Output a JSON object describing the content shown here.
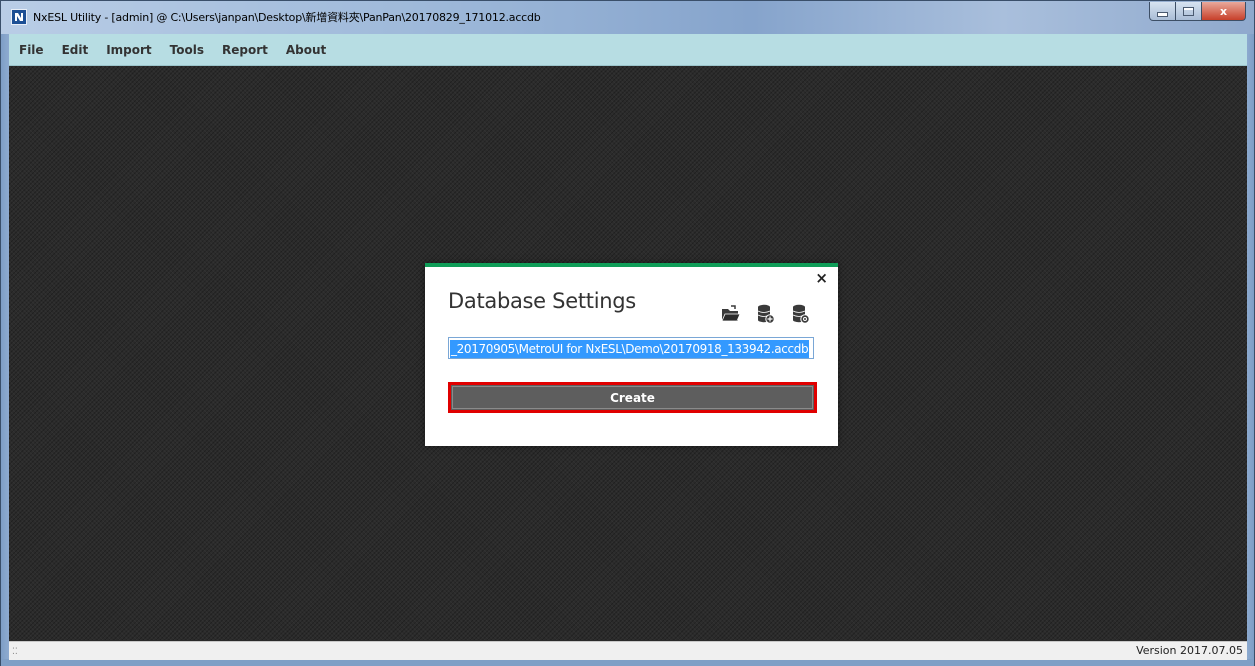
{
  "window": {
    "title": "NxESL Utility - [admin] @ C:\\Users\\janpan\\Desktop\\新增資料夾\\PanPan\\20170829_171012.accdb",
    "icon": "app-icon",
    "controls": {
      "minimize_icon": "minimize-icon",
      "maximize_icon": "maximize-icon",
      "close_label": "x"
    }
  },
  "menubar": {
    "items": [
      {
        "label": "File"
      },
      {
        "label": "Edit"
      },
      {
        "label": "Import"
      },
      {
        "label": "Tools"
      },
      {
        "label": "Report"
      },
      {
        "label": "About"
      }
    ]
  },
  "dialog": {
    "title": "Database Settings",
    "close_label": "×",
    "accent_color": "#0f9d58",
    "icons": [
      "open-folder-icon",
      "database-add-icon",
      "database-settings-icon"
    ],
    "path_value": "_20170905\\MetroUI for NxESL\\Demo\\20170918_133942.accdb",
    "create_label": "Create",
    "highlight_color": "#e00000"
  },
  "statusbar": {
    "grip": "⁚⁚",
    "version": "Version 2017.07.05"
  }
}
